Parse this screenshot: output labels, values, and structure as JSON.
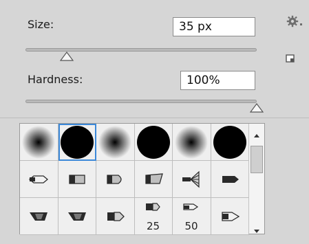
{
  "brush": {
    "size_label": "Size:",
    "size_value": "35 px",
    "size_fraction": 0.18,
    "hardness_label": "Hardness:",
    "hardness_value": "100%",
    "hardness_fraction": 1.0
  },
  "brushes": [
    {
      "kind": "soft-round"
    },
    {
      "kind": "hard-round",
      "selected": true
    },
    {
      "kind": "soft-round"
    },
    {
      "kind": "hard-round"
    },
    {
      "kind": "soft-round"
    },
    {
      "kind": "hard-round"
    },
    {
      "kind": "tip-1"
    },
    {
      "kind": "tip-2"
    },
    {
      "kind": "tip-3"
    },
    {
      "kind": "tip-4"
    },
    {
      "kind": "tip-fan"
    },
    {
      "kind": "tip-5"
    },
    {
      "kind": "tip-6"
    },
    {
      "kind": "tip-6"
    },
    {
      "kind": "tip-7"
    },
    {
      "kind": "tip-8",
      "label": "25"
    },
    {
      "kind": "tip-9",
      "label": "50"
    },
    {
      "kind": "tip-10"
    }
  ],
  "icons": {
    "settings": "gear-icon",
    "new_preset": "new-preset-icon",
    "scroll_up": "chevron-up-icon",
    "scroll_down": "chevron-down-icon"
  }
}
